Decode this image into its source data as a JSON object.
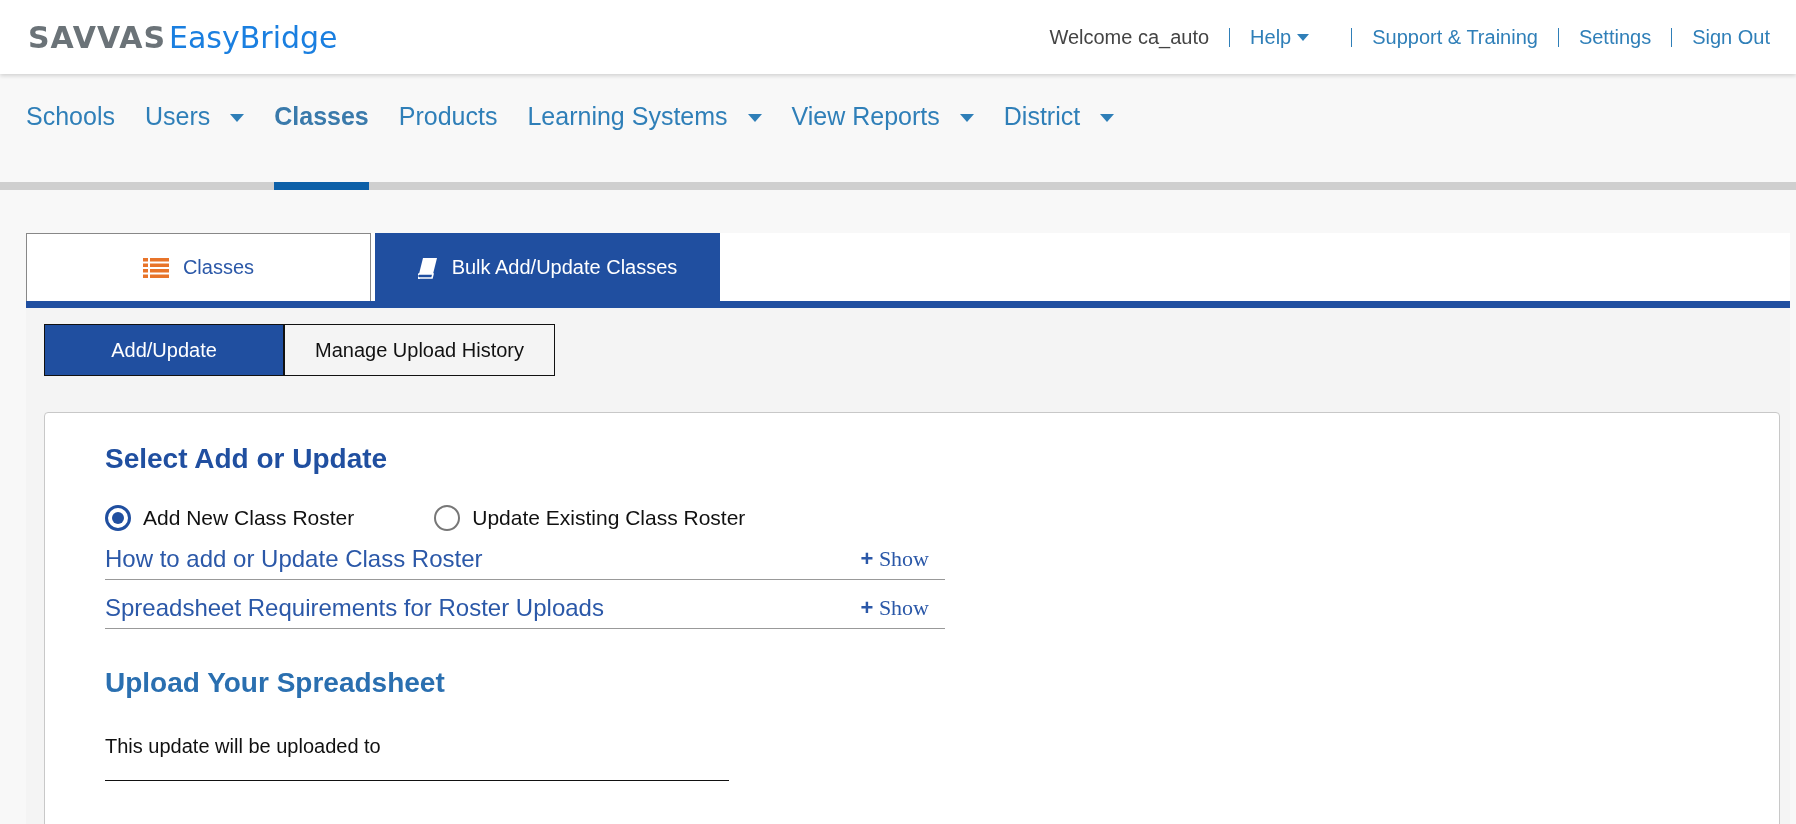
{
  "header": {
    "logo": {
      "brand": "SAVVAS",
      "product": "EasyBridge"
    },
    "welcome": "Welcome ca_auto",
    "links": [
      {
        "label": "Help",
        "dropdown": true
      },
      {
        "label": "Support & Training",
        "dropdown": false
      },
      {
        "label": "Settings",
        "dropdown": false
      },
      {
        "label": "Sign Out",
        "dropdown": false
      }
    ]
  },
  "nav": [
    {
      "label": "Schools",
      "dropdown": false,
      "selected": false
    },
    {
      "label": "Users",
      "dropdown": true,
      "selected": false
    },
    {
      "label": "Classes",
      "dropdown": false,
      "selected": true
    },
    {
      "label": "Products",
      "dropdown": false,
      "selected": false
    },
    {
      "label": "Learning Systems",
      "dropdown": true,
      "selected": false
    },
    {
      "label": "View Reports",
      "dropdown": true,
      "selected": false
    },
    {
      "label": "District",
      "dropdown": true,
      "selected": false
    }
  ],
  "tabs": [
    {
      "label": "Classes",
      "kind": "list",
      "selected": false
    },
    {
      "label": "Bulk Add/Update Classes",
      "kind": "book",
      "selected": true
    }
  ],
  "subtabs": [
    {
      "label": "Add/Update",
      "selected": true
    },
    {
      "label": "Manage Upload History",
      "selected": false
    }
  ],
  "select_section": {
    "title": "Select Add or Update",
    "radios": [
      {
        "label": "Add New Class Roster",
        "selected": true
      },
      {
        "label": "Update Existing Class Roster",
        "selected": false
      }
    ],
    "accordions": [
      {
        "title": "How to add or Update Class Roster",
        "toggle_icon": "+",
        "toggle_label": "Show"
      },
      {
        "title": "Spreadsheet Requirements for Roster Uploads",
        "toggle_icon": "+",
        "toggle_label": "Show"
      }
    ]
  },
  "upload_section": {
    "title": "Upload Your Spreadsheet",
    "label": "This update will be uploaded to"
  }
}
